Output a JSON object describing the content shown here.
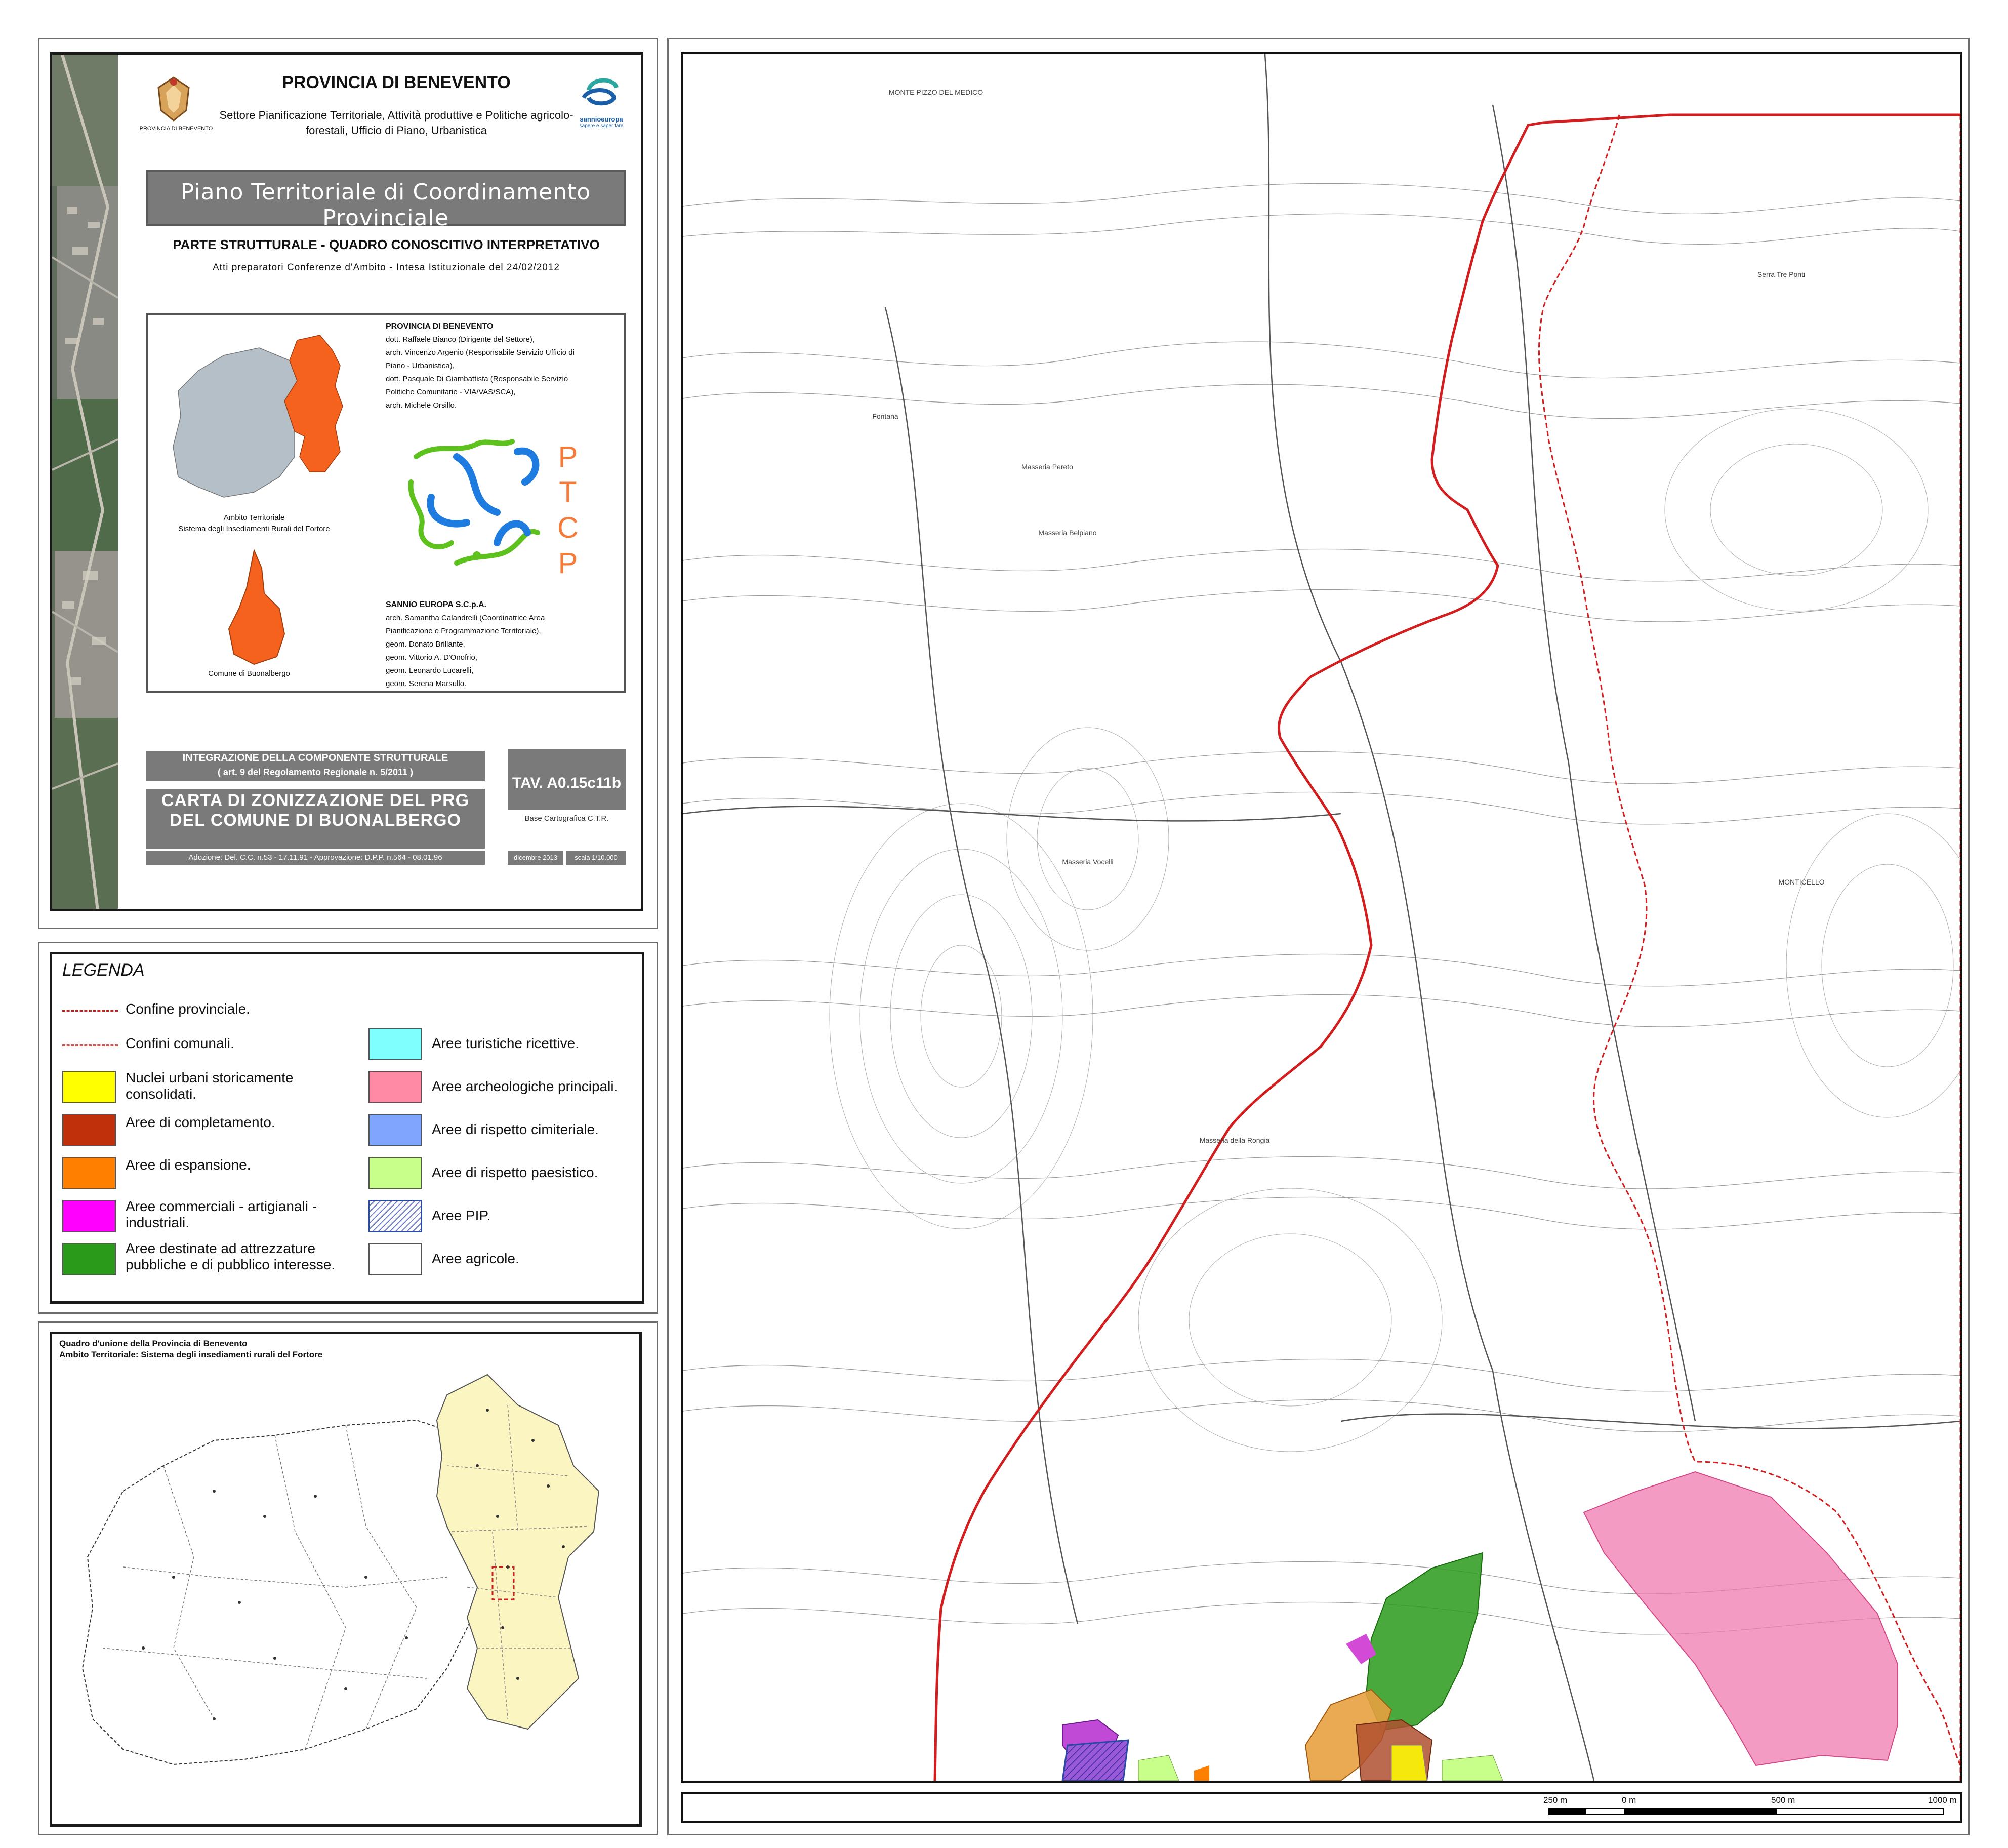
{
  "title_block": {
    "province_title": "PROVINCIA DI BENEVENTO",
    "emblem_caption": "PROVINCIA DI BENEVENTO",
    "sector": "Settore Pianificazione Territoriale, Attività produttive e Politiche agricolo-forestali, Ufficio di Piano, Urbanistica",
    "sannio_logo_text": "sannioeuropa",
    "sannio_logo_motto": "sapere e saper fare",
    "plan_name": "Piano Territoriale di Coordinamento Provinciale",
    "section": "PARTE STRUTTURALE - QUADRO CONOSCITIVO INTERPRETATIVO",
    "subtitle": "Atti preparatori Conferenze d'Ambito - Intesa Istituzionale del 24/02/2012",
    "ambito_caption_line1": "Ambito Territoriale",
    "ambito_caption_line2": "Sistema degli Insediamenti Rurali del Fortore",
    "comune_caption": "Comune di Buonalbergo",
    "ptcp_letters": [
      "P",
      "T",
      "C",
      "P"
    ],
    "credits_province": {
      "heading": "PROVINCIA DI BENEVENTO",
      "lines": [
        "dott. Raffaele Bianco (Dirigente del Settore),",
        "arch. Vincenzo Argenio (Responsabile Servizio Ufficio di",
        "Piano - Urbanistica),",
        "dott. Pasquale Di Giambattista (Responsabile Servizio",
        "Politiche Comunitarie - VIA/VAS/SCA),",
        "arch. Michele Orsillo."
      ]
    },
    "credits_sannio": {
      "heading": "SANNIO EUROPA S.C.p.A.",
      "lines": [
        "arch. Samantha Calandrelli (Coordinatrice Area",
        "Pianificazione e Programmazione Territoriale),",
        "geom. Donato Brillante,",
        "geom. Vittorio A. D'Onofrio,",
        "geom. Leonardo Lucarelli,",
        "geom. Serena Marsullo."
      ]
    },
    "integration_line1": "INTEGRAZIONE DELLA COMPONENTE STRUTTURALE",
    "integration_line2": "( art. 9 del Regolamento Regionale n. 5/2011 )",
    "map_title_line1": "CARTA DI ZONIZZAZIONE DEL PRG",
    "map_title_line2": "DEL COMUNE DI BUONALBERGO",
    "adoption": "Adozione: Del. C.C. n.53 - 17.11.91 - Approvazione: D.P.P. n.564 - 08.01.96",
    "tav_code": "TAV. A0.15c11b",
    "base_map": "Base Cartografica C.T.R.",
    "date": "dicembre 2013",
    "scale": "scala 1/10.000"
  },
  "legend": {
    "title": "LEGENDA",
    "items_left": [
      {
        "label": "Confine provinciale.",
        "kind": "line",
        "color": "#c81e1e"
      },
      {
        "label": "Confini comunali.",
        "kind": "line",
        "color": "#d9534f"
      },
      {
        "label": "Nuclei urbani storicamente consolidati.",
        "kind": "fill",
        "color": "#ffff00"
      },
      {
        "label": "Aree di completamento.",
        "kind": "fill",
        "color": "#c0300a"
      },
      {
        "label": "Aree di espansione.",
        "kind": "fill",
        "color": "#ff8000"
      },
      {
        "label": "Aree commerciali - artigianali - industriali.",
        "kind": "fill",
        "color": "#ff00ff"
      },
      {
        "label": "Aree destinate ad attrezzature pubbliche e di pubblico interesse.",
        "kind": "fill",
        "color": "#2a9a1a"
      }
    ],
    "items_right": [
      {
        "label": "Aree turistiche ricettive.",
        "kind": "fill",
        "color": "#80ffff"
      },
      {
        "label": "Aree archeologiche principali.",
        "kind": "fill",
        "color": "#ff8aa6"
      },
      {
        "label": "Aree di rispetto cimiteriale.",
        "kind": "fill",
        "color": "#7fa5ff"
      },
      {
        "label": "Aree di rispetto paesistico.",
        "kind": "fill",
        "color": "#c8ff8a"
      },
      {
        "label": "Aree PIP.",
        "kind": "hatch",
        "color": "#2a4aa8"
      },
      {
        "label": "Aree agricole.",
        "kind": "fill",
        "color": "#ffffff"
      }
    ]
  },
  "overview": {
    "title_line1": "Quadro d'unione della Provincia di Benevento",
    "title_line2": "Ambito Territoriale: Sistema degli insediamenti rurali del Fortore"
  },
  "map": {
    "scalebar_labels": [
      "250 m",
      "0 m",
      "500 m",
      "1000 m"
    ],
    "place_names": [
      "MONTE PIZZO DEL MEDICO",
      "Fontana",
      "Masseria Pereto",
      "Masseria Belpiano",
      "Masseria Vocelli",
      "MONTICELLO",
      "Serra Tre Ponti",
      "Masseria della Rongia"
    ]
  },
  "colors": {
    "frame": "#6d6d6d",
    "grey_band": "#7a7a7a",
    "province_orange": "#f4621e",
    "province_grey": "#b4bfc7",
    "overview_fill": "#fbf5c2",
    "boundary_red": "#d21e1e",
    "archaeology_pink": "#f07ab0"
  }
}
